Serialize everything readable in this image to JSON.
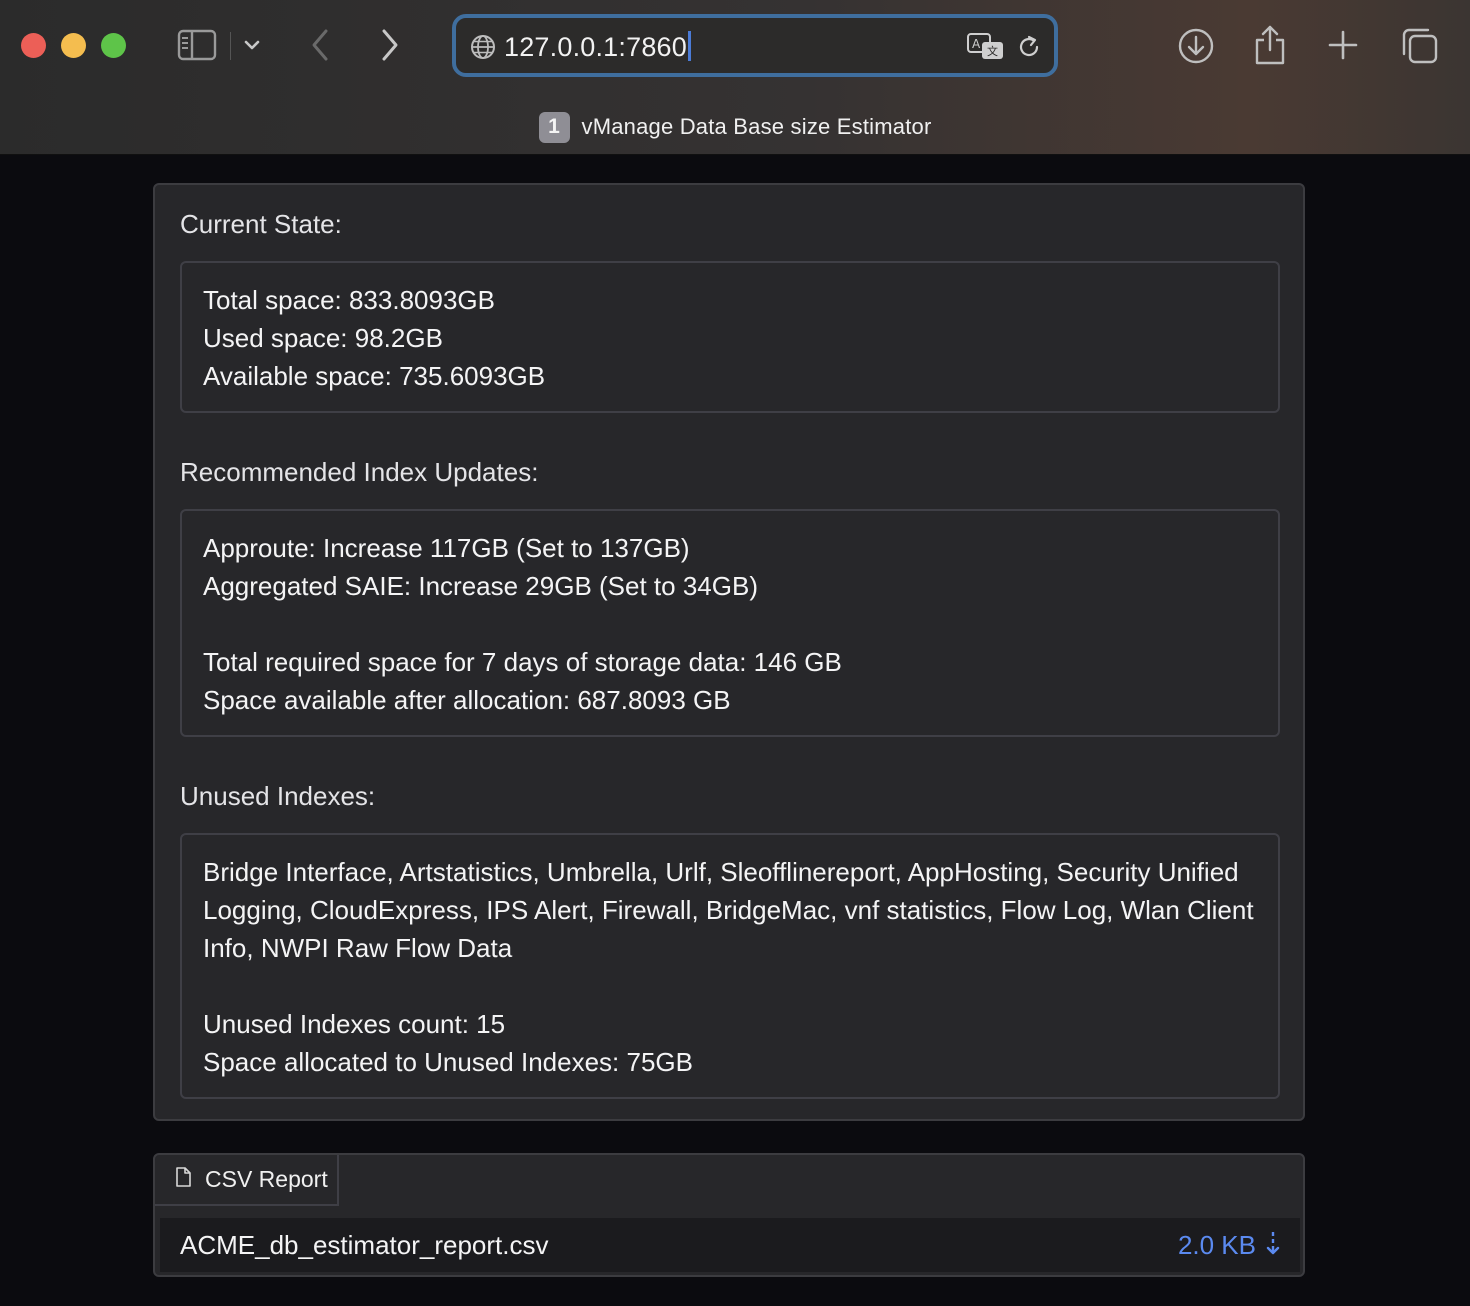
{
  "browser": {
    "url": "127.0.0.1:7860",
    "tab_number": "1",
    "tab_title": "vManage Data Base size Estimator",
    "icons": [
      "sidebar-icon",
      "chevron-down-icon",
      "back-icon",
      "forward-icon",
      "globe-icon",
      "translate-icon",
      "reload-icon",
      "download-icon",
      "share-icon",
      "new-tab-icon",
      "tab-overview-icon"
    ]
  },
  "current_state": {
    "label": "Current State:",
    "total_space": "Total space: 833.8093GB",
    "used_space": "Used space: 98.2GB",
    "available_space": "Available space: 735.6093GB"
  },
  "recommended": {
    "label": "Recommended Index Updates:",
    "approute": "Approute: Increase 117GB (Set to 137GB)",
    "aggregated_saie": "Aggregated SAIE: Increase 29GB (Set to 34GB)",
    "total_required": "Total required space for 7 days of storage data: 146 GB",
    "space_after": "Space available after allocation: 687.8093 GB"
  },
  "unused": {
    "label": "Unused Indexes:",
    "list_line1": "Bridge Interface, Artstatistics, Umbrella, Urlf, Sleofflinereport, AppHosting, Security Unified",
    "list_line2": "Logging, CloudExpress, IPS Alert, Firewall, BridgeMac, vnf statistics, Flow Log, Wlan Client",
    "list_line3": "Info, NWPI Raw Flow Data",
    "count": "Unused Indexes count: 15",
    "space_allocated": "Space allocated to Unused Indexes: 75GB"
  },
  "file": {
    "tab_label": "CSV Report",
    "name": "ACME_db_estimator_report.csv",
    "size": "2.0 KB"
  },
  "colors": {
    "accent_blue": "#5b8af0",
    "url_focus": "#3f6e9e",
    "panel_bg": "#27272a"
  }
}
